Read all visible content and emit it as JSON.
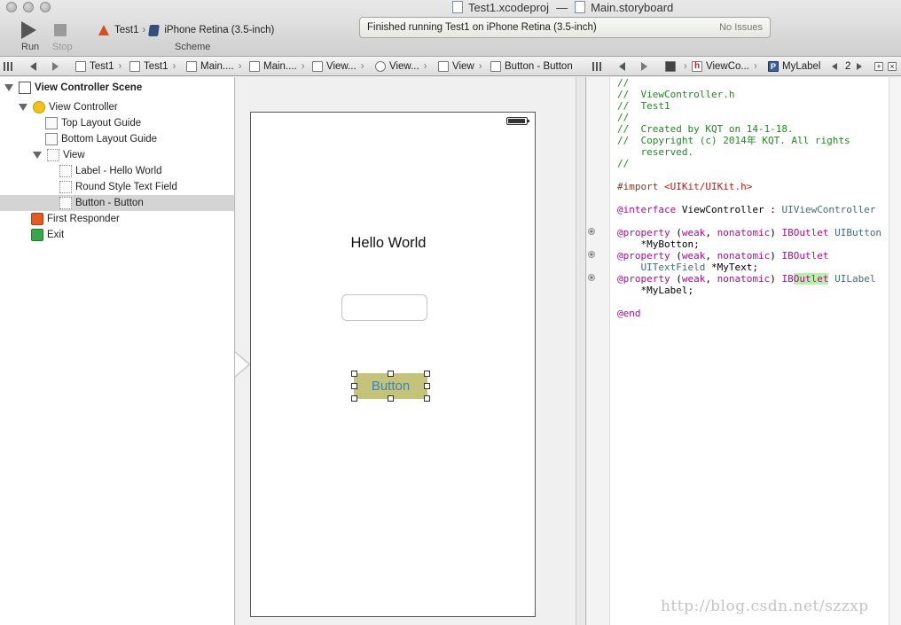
{
  "toolbar": {
    "run_label": "Run",
    "stop_label": "Stop",
    "scheme_target": "Test1",
    "scheme_device": "iPhone Retina (3.5-inch)",
    "scheme_label": "Scheme",
    "title_project": "Test1.xcodeproj",
    "title_file": "Main.storyboard",
    "title_separator": "—",
    "activity_message": "Finished running Test1 on iPhone Retina (3.5-inch)",
    "activity_issues": "No Issues"
  },
  "jumpbar_left": [
    "Test1",
    "Test1",
    "Main....",
    "Main....",
    "View...",
    "View...",
    "View",
    "Button - Button"
  ],
  "jumpbar_right": {
    "item1": "ViewCo...",
    "item2": "MyLabel",
    "counter": "2"
  },
  "outline": {
    "scene": "View Controller Scene",
    "view_controller": "View Controller",
    "top_layout_guide": "Top Layout Guide",
    "bottom_layout_guide": "Bottom Layout Guide",
    "view": "View",
    "label": "Label - Hello World",
    "text_field": "Round Style Text Field",
    "button": "Button - Button",
    "first_responder": "First Responder",
    "exit": "Exit"
  },
  "canvas": {
    "label_text": "Hello World",
    "button_text": "Button"
  },
  "code": {
    "line1": "//",
    "line2": "//  ViewController.h",
    "line3": "//  Test1",
    "line4": "//",
    "line5": "//  Created by KQT on 14-1-18.",
    "line6": "//  Copyright (c) 2014年 KQT. All rights",
    "line7": "    reserved.",
    "line8": "//",
    "import_kw": "#import",
    "import_path": "<UIKit/UIKit.h>",
    "interface_kw": "@interface",
    "interface_name": "ViewController",
    "interface_colon": ":",
    "interface_super": "UIViewController",
    "property_kw": "@property",
    "weak": "weak",
    "nonatomic": "nonatomic",
    "iboutlet": "IBOutlet",
    "ib_prefix": "IB",
    "ib_outlet_hl": "Outlet",
    "type1": "UIButton",
    "var1": "    *MyBotton;",
    "type2": "UITextField",
    "var2": "*MyText;",
    "type3": "UILabel",
    "var3": "    *MyLabel;",
    "end_kw": "@end"
  },
  "watermark": "http://blog.csdn.net/szzxp"
}
